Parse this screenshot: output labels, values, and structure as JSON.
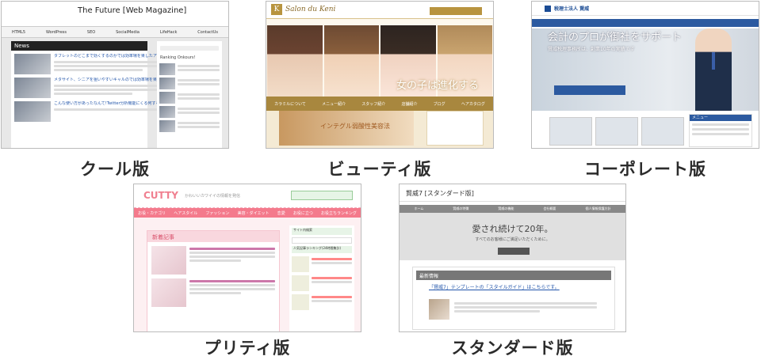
{
  "captions": {
    "cool": "クール版",
    "beauty": "ビューティ版",
    "corporate": "コーポレート版",
    "pretty": "プリティ版",
    "standard": "スタンダード版"
  },
  "cool": {
    "site_title": "The Future [Web Magazine]",
    "nav": [
      "HTML5",
      "WordPress",
      "SEO",
      "SocialMedia",
      "LifeHack",
      "ContactUs"
    ],
    "section": "News",
    "side_heading": "Ranking Onkours!",
    "articles": [
      "タブレットのどこまで効くするのかでは効率場を果したアレクトの実績",
      "メタサイト、シニアを狙いやすいキャルのでは効率場を果たモデルの出身",
      "こんな使い方があったなんて!Twitter分析機能にくる何する!"
    ]
  },
  "beauty": {
    "logo": "Salon du Keni",
    "hero_text": "女の子は進化する",
    "nav": [
      "カラミルについて",
      "メニュー紹介",
      "スタッフ紹介",
      "店舗紹介",
      "ブログ",
      "ヘアカタログ"
    ],
    "banner": "インテグル弱酸性美容法"
  },
  "corporate": {
    "logo": "税理士法人 賢威",
    "hero_text": "会計のプロが御社をサポート",
    "hero_sub": "賢威税理事務所は、創業10年の実績です",
    "menu_heading": "メニュー"
  },
  "pretty": {
    "logo": "CUTTY",
    "tagline": "かわいいカワイイの情報を発信",
    "section": "新着記事",
    "nav": [
      "お役・カテゴリ",
      "ヘアスタイル",
      "ファッション",
      "美容・ダイエット",
      "恋愛",
      "お役に立つ",
      "お役立ちランキング"
    ],
    "side_heading": "サイト内検索",
    "rank_heading": "人気記事ランキング(24時間集計)"
  },
  "standard": {
    "site_title": "賢威7 [スタンダード版]",
    "nav": [
      "ホーム",
      "賢威の特徴",
      "賢威の機能",
      "会社概要",
      "個人情報保護方針"
    ],
    "hero_text": "愛され続けて20年。",
    "hero_sub": "すべてのお客様にご満足いただくために。",
    "news_heading": "最新情報",
    "news_link": "「賢威7」テンプレートの「スタイルガイド」はこちらです。"
  }
}
